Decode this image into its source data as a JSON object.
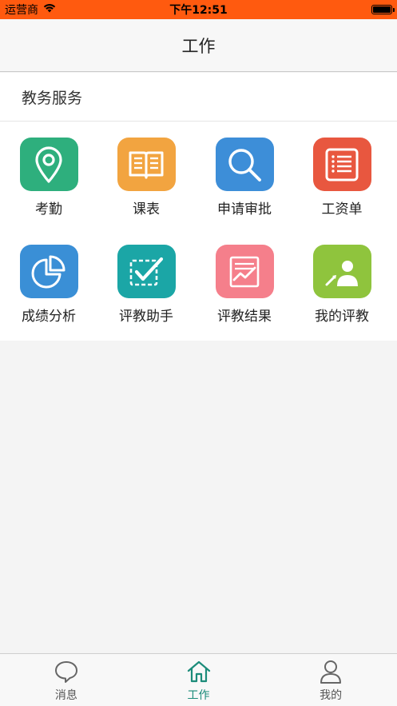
{
  "status_bar": {
    "carrier": "运营商",
    "time": "下午12:51",
    "battery_level": 1.0
  },
  "nav": {
    "title": "工作"
  },
  "section": {
    "title": "教务服务"
  },
  "grid": {
    "items": [
      {
        "label": "考勤",
        "icon": "location-pin-icon",
        "color": "#2eaf7d"
      },
      {
        "label": "课表",
        "icon": "open-book-icon",
        "color": "#f2a440"
      },
      {
        "label": "申请审批",
        "icon": "search-icon",
        "color": "#3d8ed8"
      },
      {
        "label": "工资单",
        "icon": "list-document-icon",
        "color": "#e8573f"
      },
      {
        "label": "成绩分析",
        "icon": "pie-chart-icon",
        "color": "#3a8fd6"
      },
      {
        "label": "评教助手",
        "icon": "checkbox-icon",
        "color": "#1ba6a6"
      },
      {
        "label": "评教结果",
        "icon": "result-chart-icon",
        "color": "#f57f8b"
      },
      {
        "label": "我的评教",
        "icon": "person-search-icon",
        "color": "#8fc43d"
      }
    ]
  },
  "tabs": {
    "items": [
      {
        "label": "消息",
        "icon": "chat-bubble-icon",
        "active": false
      },
      {
        "label": "工作",
        "icon": "home-icon",
        "active": true
      },
      {
        "label": "我的",
        "icon": "user-icon",
        "active": false
      }
    ],
    "active_color": "#1c8c7a",
    "inactive_color": "#666666"
  }
}
